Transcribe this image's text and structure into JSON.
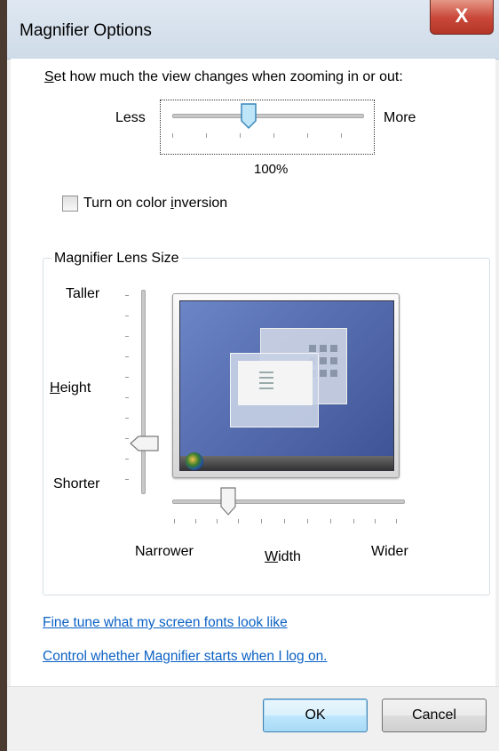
{
  "window": {
    "title": "Magnifier Options",
    "close_glyph": "X"
  },
  "zoom": {
    "label_prefix": "",
    "label_accel": "S",
    "label_rest": "et how much the view changes when zooming in or out:",
    "less": "Less",
    "more": "More",
    "value": "100%",
    "slider_fraction": 0.43
  },
  "color_inversion": {
    "label_before": "Turn on color ",
    "label_accel": "i",
    "label_after": "nversion",
    "checked": false
  },
  "lens_size": {
    "group_label": "Magnifier Lens Size",
    "taller": "Taller",
    "height_accel": "H",
    "height_rest": "eight",
    "shorter": "Shorter",
    "narrower": "Narrower",
    "width_accel": "W",
    "width_rest": "idth",
    "wider": "Wider",
    "height_fraction": 0.2,
    "width_fraction": 0.25
  },
  "links": {
    "fonts": "Fine tune what my screen fonts look like",
    "startup": "Control whether Magnifier starts when I log on."
  },
  "buttons": {
    "ok": "OK",
    "cancel": "Cancel"
  },
  "colors": {
    "link": "#0b61c4",
    "close_button": "#c9483a",
    "preview_desktop": "#4a62a8"
  }
}
